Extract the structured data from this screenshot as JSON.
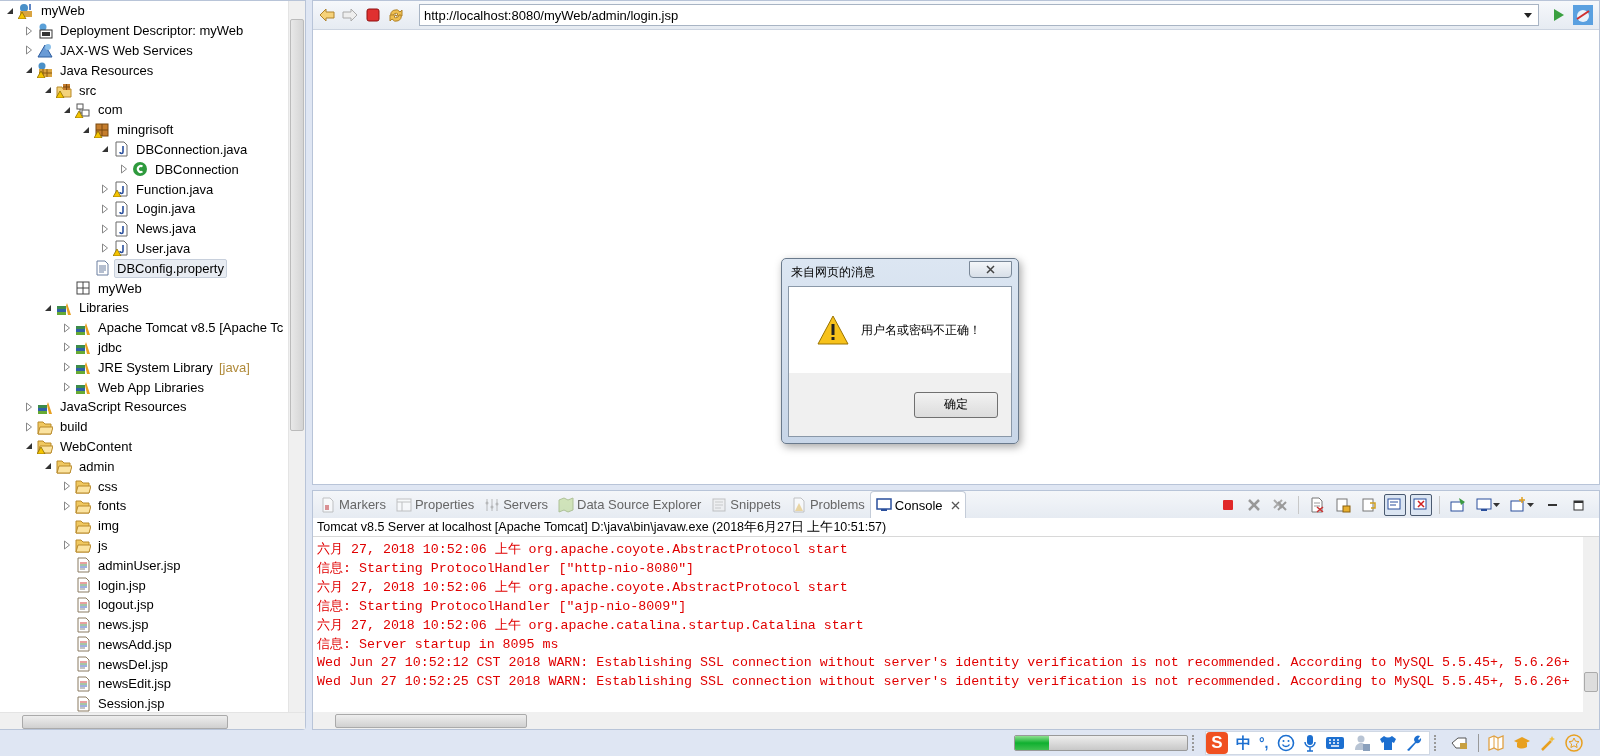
{
  "tree": [
    {
      "label": "myWeb",
      "kind": "project",
      "warning": true,
      "expanded": true,
      "selected": false,
      "children": [
        {
          "label": "Deployment Descriptor: myWeb",
          "kind": "descriptor",
          "warning": false,
          "expanded": false,
          "selected": false
        },
        {
          "label": "JAX-WS Web Services",
          "kind": "webservices",
          "warning": false,
          "expanded": false,
          "selected": false
        },
        {
          "label": "Java Resources",
          "kind": "javaresources",
          "warning": true,
          "expanded": true,
          "selected": false,
          "children": [
            {
              "label": "src",
              "kind": "srcfolder",
              "warning": true,
              "expanded": true,
              "selected": false,
              "children": [
                {
                  "label": "com",
                  "kind": "emptypackage",
                  "warning": true,
                  "expanded": true,
                  "selected": false,
                  "children": [
                    {
                      "label": "mingrisoft",
                      "kind": "package",
                      "warning": true,
                      "expanded": true,
                      "selected": false,
                      "children": [
                        {
                          "label": "DBConnection.java",
                          "kind": "java",
                          "warning": false,
                          "expanded": true,
                          "selected": false,
                          "children": [
                            {
                              "label": "DBConnection",
                              "kind": "class",
                              "warning": false,
                              "expanded": false,
                              "selected": false
                            }
                          ]
                        },
                        {
                          "label": "Function.java",
                          "kind": "java",
                          "warning": true,
                          "expanded": false,
                          "selected": false
                        },
                        {
                          "label": "Login.java",
                          "kind": "java",
                          "warning": false,
                          "expanded": false,
                          "selected": false
                        },
                        {
                          "label": "News.java",
                          "kind": "java",
                          "warning": false,
                          "expanded": false,
                          "selected": false
                        },
                        {
                          "label": "User.java",
                          "kind": "java",
                          "warning": true,
                          "expanded": false,
                          "selected": false
                        }
                      ]
                    },
                    {
                      "label": "DBConfig.property",
                      "kind": "text",
                      "warning": false,
                      "selected": true
                    }
                  ]
                },
                {
                  "label": "myWeb",
                  "kind": "grid",
                  "warning": false,
                  "selected": false
                }
              ]
            },
            {
              "label": "Libraries",
              "kind": "library",
              "warning": false,
              "expanded": true,
              "selected": false,
              "children": [
                {
                  "label": "Apache Tomcat v8.5 [Apache Tc",
                  "kind": "library",
                  "warning": false,
                  "expanded": false,
                  "selected": false
                },
                {
                  "label": "jdbc",
                  "kind": "library",
                  "warning": false,
                  "expanded": false,
                  "selected": false
                },
                {
                  "label": "JRE System Library",
                  "decoration": "[java]",
                  "kind": "library",
                  "warning": false,
                  "expanded": false,
                  "selected": false
                },
                {
                  "label": "Web App Libraries",
                  "kind": "library",
                  "warning": false,
                  "expanded": false,
                  "selected": false
                }
              ]
            }
          ]
        },
        {
          "label": "JavaScript Resources",
          "kind": "library",
          "warning": false,
          "expanded": false,
          "selected": false
        },
        {
          "label": "build",
          "kind": "folder",
          "warning": false,
          "expanded": false,
          "selected": false
        },
        {
          "label": "WebContent",
          "kind": "folder",
          "warning": true,
          "expanded": true,
          "selected": false,
          "children": [
            {
              "label": "admin",
              "kind": "folder",
              "warning": false,
              "expanded": true,
              "selected": false,
              "children": [
                {
                  "label": "css",
                  "kind": "folder",
                  "warning": false,
                  "expanded": false,
                  "selected": false
                },
                {
                  "label": "fonts",
                  "kind": "folder",
                  "warning": false,
                  "expanded": false,
                  "selected": false
                },
                {
                  "label": "img",
                  "kind": "folder",
                  "warning": false,
                  "selected": false
                },
                {
                  "label": "js",
                  "kind": "folder",
                  "warning": false,
                  "expanded": false,
                  "selected": false
                },
                {
                  "label": "adminUser.jsp",
                  "kind": "jsp",
                  "warning": false,
                  "selected": false
                },
                {
                  "label": "login.jsp",
                  "kind": "jsp",
                  "warning": false,
                  "selected": false
                },
                {
                  "label": "logout.jsp",
                  "kind": "jsp",
                  "warning": false,
                  "selected": false
                },
                {
                  "label": "news.jsp",
                  "kind": "jsp",
                  "warning": false,
                  "selected": false
                },
                {
                  "label": "newsAdd.jsp",
                  "kind": "jsp",
                  "warning": false,
                  "selected": false
                },
                {
                  "label": "newsDel.jsp",
                  "kind": "jsp",
                  "warning": false,
                  "selected": false
                },
                {
                  "label": "newsEdit.jsp",
                  "kind": "jsp",
                  "warning": false,
                  "selected": false
                },
                {
                  "label": "Session.jsp",
                  "kind": "jsp",
                  "warning": false,
                  "selected": false
                }
              ]
            }
          ]
        }
      ]
    }
  ],
  "browser": {
    "url": "http://localhost:8080/myWeb/admin/login.jsp"
  },
  "dialog": {
    "title": "来自网页的消息",
    "message": "用户名或密码不正确！",
    "button": "确定"
  },
  "console": {
    "tabs": [
      {
        "label": "Markers",
        "kind": "markers",
        "selected": false
      },
      {
        "label": "Properties",
        "kind": "properties",
        "selected": false
      },
      {
        "label": "Servers",
        "kind": "servers",
        "selected": false
      },
      {
        "label": "Data Source Explorer",
        "kind": "datasource",
        "selected": false
      },
      {
        "label": "Snippets",
        "kind": "snippets",
        "selected": false
      },
      {
        "label": "Problems",
        "kind": "problems",
        "selected": false
      },
      {
        "label": "Console",
        "kind": "console",
        "selected": true
      }
    ],
    "toolbar": [
      {
        "kind": "terminate",
        "on": false
      },
      {
        "kind": "remove",
        "on": false
      },
      {
        "kind": "removeall",
        "on": false
      },
      {
        "kind": "sep"
      },
      {
        "kind": "clear",
        "on": false
      },
      {
        "kind": "lock",
        "on": false
      },
      {
        "kind": "wrap",
        "on": false
      },
      {
        "kind": "stdout",
        "on": true
      },
      {
        "kind": "stderr",
        "on": true
      },
      {
        "kind": "sep"
      },
      {
        "kind": "pin",
        "on": false
      },
      {
        "kind": "display",
        "on": false
      },
      {
        "kind": "open",
        "on": false
      },
      {
        "kind": "minimize",
        "on": false
      },
      {
        "kind": "maximize",
        "on": false
      }
    ],
    "header": "Tomcat v8.5 Server at localhost [Apache Tomcat] D:\\java\\bin\\javaw.exe (2018年6月27日 上午10:51:57)",
    "lines": [
      "六月 27, 2018 10:52:06 上午 org.apache.coyote.AbstractProtocol start",
      "信息: Starting ProtocolHandler [\"http-nio-8080\"]",
      "六月 27, 2018 10:52:06 上午 org.apache.coyote.AbstractProtocol start",
      "信息: Starting ProtocolHandler [\"ajp-nio-8009\"]",
      "六月 27, 2018 10:52:06 上午 org.apache.catalina.startup.Catalina start",
      "信息: Server startup in 8095 ms",
      "Wed Jun 27 10:52:12 CST 2018 WARN: Establishing SSL connection without server's identity verification is not recommended. According to MySQL 5.5.45+, 5.6.26+",
      "Wed Jun 27 10:52:25 CST 2018 WARN: Establishing SSL connection without server's identity verification is not recommended. According to MySQL 5.5.45+, 5.6.26+"
    ]
  },
  "status": {
    "progress": {
      "level": 0.2
    },
    "ime": {
      "logo": "S",
      "mode": "中",
      "punct": "°,"
    }
  }
}
